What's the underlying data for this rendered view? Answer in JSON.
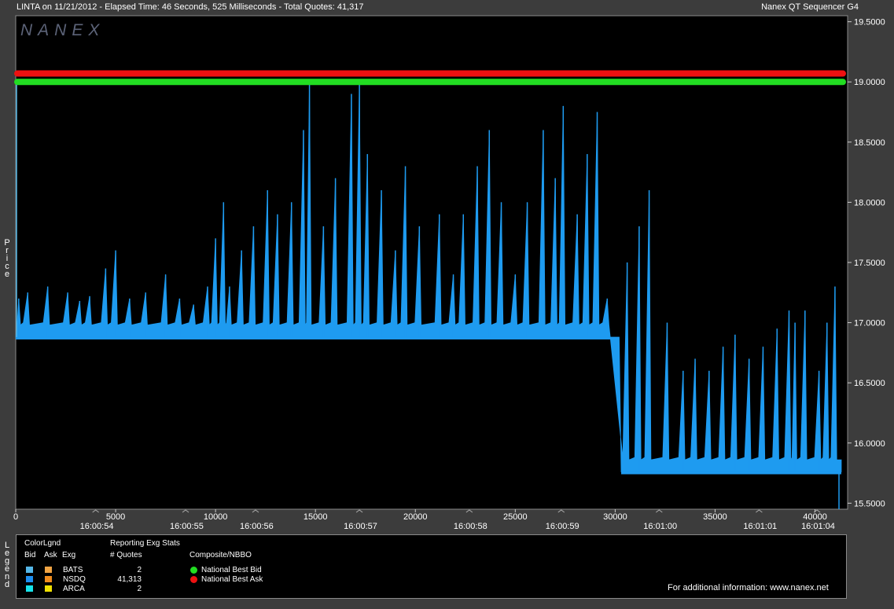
{
  "header": {
    "left": "LINTA on 11/21/2012  -  Elapsed Time: 46 Seconds, 525 Milliseconds  -  Total Quotes: 41,317",
    "right": "Nanex QT Sequencer G4"
  },
  "logo_text": "NANEX",
  "chart_data": {
    "type": "area",
    "ylabel": "Price",
    "ylim": [
      15.45,
      19.55
    ],
    "xlim": [
      0,
      41317
    ],
    "y_ticks": [
      "19.5000",
      "19.0000",
      "18.5000",
      "18.0000",
      "17.5000",
      "17.0000",
      "16.5000",
      "16.0000",
      "15.5000"
    ],
    "x_ticks": [
      "0",
      "5000",
      "10000",
      "15000",
      "20000",
      "25000",
      "30000",
      "35000",
      "40000"
    ],
    "time_ticks": [
      "16:00:54",
      "16:00:55",
      "16:00:56",
      "16:00:57",
      "16:00:58",
      "16:00:59",
      "16:01:00",
      "16:01:01",
      "16:01:04"
    ],
    "nbbo": {
      "best_ask": 19.07,
      "best_bid": 19.0
    },
    "series": [
      {
        "name": "NSDQ",
        "color": "#1e9bf0",
        "baseline": [
          [
            0,
            16.88
          ],
          [
            30200,
            16.88
          ],
          [
            30300,
            15.76
          ],
          [
            41317,
            15.76
          ]
        ],
        "spikes": [
          [
            150,
            17.2
          ],
          [
            600,
            17.25
          ],
          [
            1600,
            17.3
          ],
          [
            2600,
            17.25
          ],
          [
            3200,
            17.18
          ],
          [
            3700,
            17.22
          ],
          [
            4500,
            17.45
          ],
          [
            5000,
            17.6
          ],
          [
            5700,
            17.2
          ],
          [
            6500,
            17.25
          ],
          [
            7500,
            17.4
          ],
          [
            8200,
            17.2
          ],
          [
            8900,
            17.15
          ],
          [
            9600,
            17.3
          ],
          [
            10000,
            17.7
          ],
          [
            10400,
            18.0
          ],
          [
            10700,
            17.3
          ],
          [
            11300,
            17.6
          ],
          [
            11900,
            17.8
          ],
          [
            12600,
            18.1
          ],
          [
            13100,
            17.9
          ],
          [
            13800,
            18.0
          ],
          [
            14400,
            18.6
          ],
          [
            14700,
            19.0
          ],
          [
            15400,
            17.8
          ],
          [
            16000,
            18.2
          ],
          [
            16800,
            18.9
          ],
          [
            17200,
            19.0
          ],
          [
            17600,
            18.4
          ],
          [
            18300,
            18.1
          ],
          [
            19000,
            17.6
          ],
          [
            19500,
            18.3
          ],
          [
            20200,
            17.8
          ],
          [
            21200,
            17.9
          ],
          [
            21900,
            17.4
          ],
          [
            22400,
            17.9
          ],
          [
            23100,
            18.3
          ],
          [
            23700,
            18.6
          ],
          [
            24300,
            18.0
          ],
          [
            25000,
            17.4
          ],
          [
            25600,
            18.0
          ],
          [
            26400,
            18.6
          ],
          [
            27000,
            18.2
          ],
          [
            27400,
            18.8
          ],
          [
            28100,
            17.9
          ],
          [
            28600,
            18.4
          ],
          [
            29100,
            18.75
          ],
          [
            29600,
            17.2
          ],
          [
            30600,
            17.5
          ],
          [
            31200,
            17.8
          ],
          [
            31700,
            18.1
          ],
          [
            32600,
            17.0
          ],
          [
            33400,
            16.6
          ],
          [
            34000,
            16.7
          ],
          [
            34700,
            16.6
          ],
          [
            35400,
            16.8
          ],
          [
            36000,
            16.9
          ],
          [
            36700,
            16.7
          ],
          [
            37400,
            16.8
          ],
          [
            38100,
            16.95
          ],
          [
            38700,
            17.1
          ],
          [
            39000,
            17.0
          ],
          [
            39500,
            17.1
          ],
          [
            40200,
            16.6
          ],
          [
            40600,
            17.0
          ],
          [
            41000,
            17.3
          ]
        ]
      },
      {
        "name": "BATS",
        "color": "#55b7e8",
        "spikes": []
      },
      {
        "name": "ARCA",
        "color": "#16e3ea",
        "spikes": []
      }
    ]
  },
  "legend": {
    "title": "Legend",
    "color_legend": "ColorLgnd",
    "col_bid": "Bid",
    "col_ask": "Ask",
    "col_exg": "Exg",
    "reporting_title": "Reporting Exg Stats",
    "quotes_header": "# Quotes",
    "composite_title": "Composite/NBBO",
    "exchanges": [
      {
        "name": "BATS",
        "quotes": "2",
        "bid_color": "#55b7e8",
        "ask_color": "#f0a444"
      },
      {
        "name": "NSDQ",
        "quotes": "41,313",
        "bid_color": "#1e8ff0",
        "ask_color": "#f08c1e"
      },
      {
        "name": "ARCA",
        "quotes": "2",
        "bid_color": "#16e3ea",
        "ask_color": "#f0e000"
      }
    ],
    "nbbo": [
      {
        "label": "National Best Bid",
        "color": "#22dd22"
      },
      {
        "label": "National Best Ask",
        "color": "#ee1111"
      }
    ],
    "footer": "For additional information: www.nanex.net"
  }
}
